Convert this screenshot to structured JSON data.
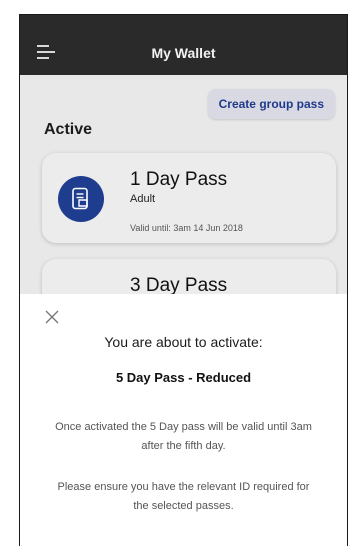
{
  "header": {
    "title": "My Wallet",
    "menu_icon": "hamburger-menu-icon"
  },
  "actions": {
    "create_group_pass": "Create group pass"
  },
  "active_section": {
    "title": "Active",
    "passes": [
      {
        "name": "1 Day Pass",
        "type": "Adult",
        "valid_until": "Valid until: 3am 14 Jun 2018",
        "icon": "phone-ticket-icon"
      },
      {
        "name": "3 Day Pass",
        "icon": "phone-ticket-icon"
      }
    ]
  },
  "activation_sheet": {
    "close_icon": "close-icon",
    "heading": "You are about to activate:",
    "pass_name": "5 Day Pass - Reduced",
    "info_validity": "Once activated the 5 Day pass will be valid until 3am after the fifth day.",
    "info_id": "Please ensure you have the relevant ID required for the selected passes."
  },
  "colors": {
    "brand_blue": "#1f3d8f",
    "top_bar": "#2a2a2a",
    "background": "#e8e8e8",
    "sheet": "#ffffff"
  }
}
